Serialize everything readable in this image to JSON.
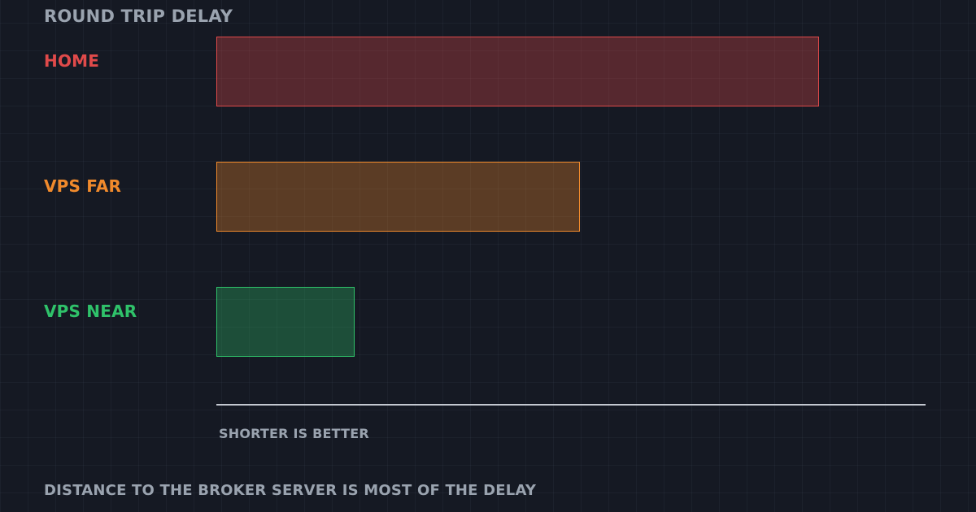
{
  "chart_data": {
    "type": "bar",
    "orientation": "horizontal",
    "title": "ROUND TRIP DELAY",
    "categories": [
      "HOME",
      "VPS FAR",
      "VPS NEAR"
    ],
    "values": [
      85,
      51.3,
      19.5
    ],
    "colors": [
      "#e04a4a",
      "#f08a2c",
      "#2fc26a"
    ],
    "xlim": [
      0,
      100
    ],
    "axis_note": "SHORTER IS BETTER",
    "footer": "DISTANCE TO THE BROKER SERVER IS MOST OF THE DELAY",
    "grid": true
  }
}
